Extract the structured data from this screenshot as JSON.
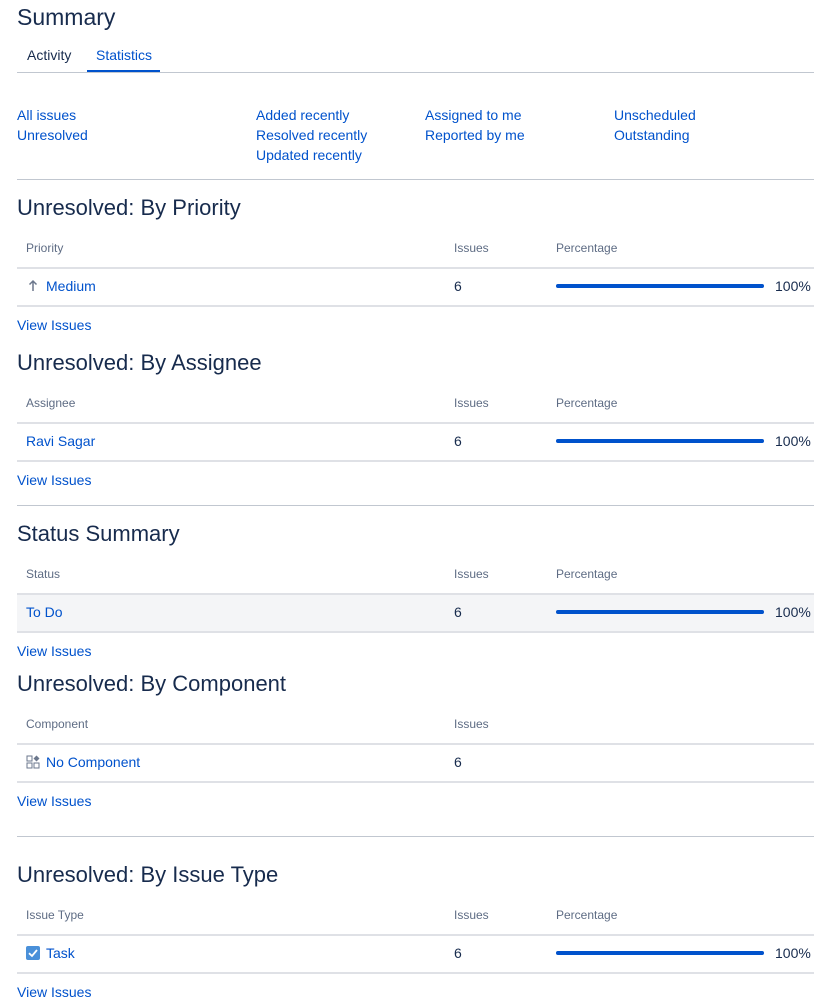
{
  "header": {
    "title": "Summary"
  },
  "tabs": [
    {
      "label": "Activity"
    },
    {
      "label": "Statistics"
    }
  ],
  "filters": {
    "col1": [
      "All issues",
      "Unresolved"
    ],
    "col2": [
      "Added recently",
      "Resolved recently",
      "Updated recently"
    ],
    "col3": [
      "Assigned to me",
      "Reported by me"
    ],
    "col4": [
      "Unscheduled",
      "Outstanding"
    ]
  },
  "sections": {
    "priority": {
      "title": "Unresolved: By Priority",
      "headers": [
        "Priority",
        "Issues",
        "Percentage"
      ],
      "row": {
        "name": "Medium",
        "icon": "arrow-up-icon",
        "issues": "6",
        "percent": "100%",
        "fraction": 1.0
      },
      "view": "View Issues"
    },
    "assignee": {
      "title": "Unresolved: By Assignee",
      "headers": [
        "Assignee",
        "Issues",
        "Percentage"
      ],
      "row": {
        "name": "Ravi Sagar",
        "issues": "6",
        "percent": "100%",
        "fraction": 1.0
      },
      "view": "View Issues"
    },
    "status": {
      "title": "Status Summary",
      "headers": [
        "Status",
        "Issues",
        "Percentage"
      ],
      "row": {
        "name": "To Do",
        "issues": "6",
        "percent": "100%",
        "fraction": 1.0
      },
      "view": "View Issues"
    },
    "component": {
      "title": "Unresolved: By Component",
      "headers": [
        "Component",
        "Issues"
      ],
      "row": {
        "name": "No Component",
        "icon": "component-icon",
        "issues": "6"
      },
      "view": "View Issues"
    },
    "issuetype": {
      "title": "Unresolved: By Issue Type",
      "headers": [
        "Issue Type",
        "Issues",
        "Percentage"
      ],
      "row": {
        "name": "Task",
        "icon": "task-checkbox-icon",
        "issues": "6",
        "percent": "100%",
        "fraction": 1.0
      },
      "view": "View Issues"
    }
  },
  "colors": {
    "link": "#0052cc",
    "text": "#172b4d",
    "muted": "#5e6c84",
    "bar": "#0052cc",
    "rowHighlight": "#f4f5f7",
    "taskIcon": "#4a90d9"
  }
}
